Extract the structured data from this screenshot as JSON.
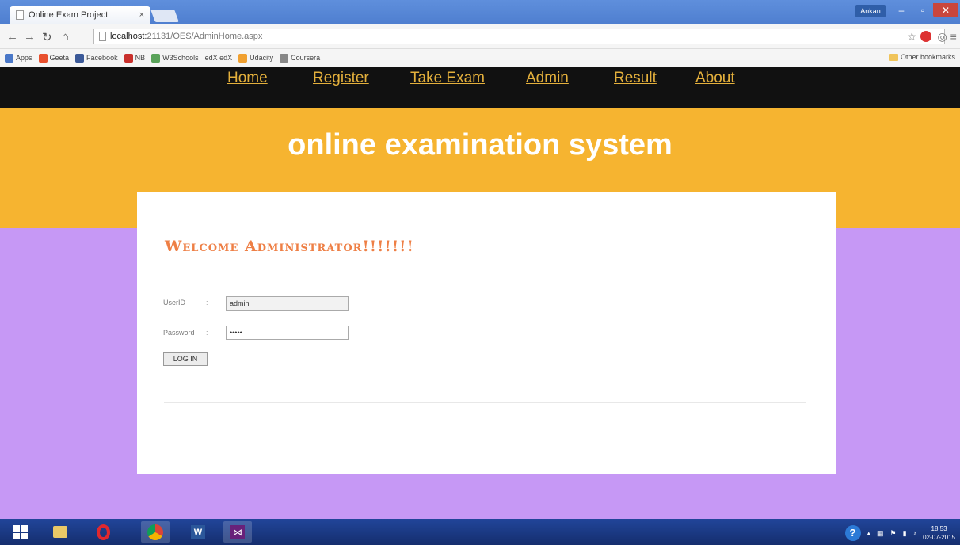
{
  "browser": {
    "tab_title": "Online Exam Project",
    "tab_close": "×",
    "profile": "Ankan",
    "url_host": "localhost:",
    "url_rest": "21131/OES/AdminHome.aspx",
    "bookmarks": [
      {
        "label": "Apps",
        "color": "#4a78c8"
      },
      {
        "label": "Geeta",
        "color": "#e8502e"
      },
      {
        "label": "Facebook",
        "color": "#3b5998"
      },
      {
        "label": "NB",
        "color": "#c9302c"
      },
      {
        "label": "W3Schools",
        "color": "#5aa35a"
      },
      {
        "label": "edX edX",
        "color": "#777777"
      },
      {
        "label": "Udacity",
        "color": "#f0a030"
      },
      {
        "label": "Coursera",
        "color": "#888888"
      }
    ],
    "other_bookmarks": "Other bookmarks"
  },
  "nav": {
    "home": "Home",
    "register": "Register",
    "take_exam": "Take Exam",
    "admin": "Admin",
    "result": "Result",
    "about": "About"
  },
  "banner": {
    "title": "online examination system"
  },
  "login": {
    "heading": "Welcome Administrator!!!!!!!",
    "userid_label": "UserID",
    "password_label": "Password",
    "colon": ":",
    "userid_value": "admin",
    "password_value": "•••••",
    "button": "LOG IN"
  },
  "taskbar": {
    "time": "18:53",
    "date": "02-07-2015",
    "help": "?"
  },
  "colors": {
    "nav_bg": "#111111",
    "nav_link": "#e4b03c",
    "banner_bg": "#f6b430",
    "page_bg": "#c698f5",
    "heading": "#ee7f45"
  }
}
